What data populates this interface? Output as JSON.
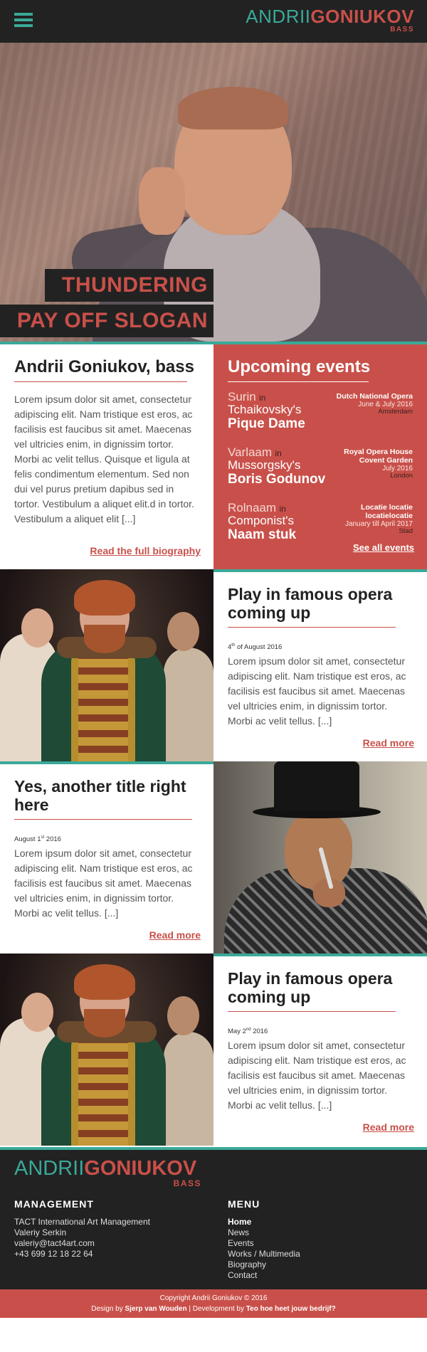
{
  "header": {
    "logo_first": "ANDRII",
    "logo_last": "GONIUKOV",
    "logo_sub": "BASS"
  },
  "hero": {
    "slogan_line1": "THUNDERING",
    "slogan_line2": "PAY OFF SLOGAN"
  },
  "bio": {
    "title": "Andrii Goniukov, bass",
    "text": "Lorem ipsum dolor sit amet, consectetur adipiscing elit. Nam tristique est eros, ac facilisis est faucibus sit amet. Maecenas vel ultricies enim, in dignissim tortor. Morbi ac velit tellus. Quisque et ligula at felis condimentum elementum. Sed non dui vel purus pretium dapibus sed in tortor. Vestibulum a aliquet elit.d in tortor. Vestibulum a aliquet elit [...]",
    "link": "Read the full biography"
  },
  "events": {
    "title": "Upcoming events",
    "in_word": "in",
    "items": [
      {
        "role": "Surin",
        "composer": "Tchaikovsky's",
        "work": "Pique Dame",
        "venue": "Dutch National Opera",
        "date": "June & July 2016",
        "city": "Amsterdam"
      },
      {
        "role": "Varlaam",
        "composer": "Mussorgsky's",
        "work": "Boris Godunov",
        "venue": "Royal Opera House Covent Garden",
        "date": "July 2016",
        "city": "London"
      },
      {
        "role": "Rolnaam",
        "composer": "Componist's",
        "work": "Naam stuk",
        "venue": "Locatie locatie locatielocatie",
        "date": "January till April 2017",
        "city": "Stad"
      }
    ],
    "see_all": "See all events"
  },
  "articles": [
    {
      "title": "Play in famous opera coming up",
      "date_day": "4",
      "date_sup": "th",
      "date_rest": " of August 2016",
      "text": "Lorem ipsum dolor sit amet, consectetur adipiscing elit. Nam tristique est eros, ac facilisis est faucibus sit amet. Maecenas vel ultricies enim, in dignissim tortor. Morbi ac velit tellus. [...]",
      "link": "Read more"
    },
    {
      "title": "Yes, another title right here",
      "date_day": "August 1",
      "date_sup": "st",
      "date_rest": " 2016",
      "text": "Lorem ipsum dolor sit amet, consectetur adipiscing elit. Nam tristique est eros, ac facilisis est faucibus sit amet. Maecenas vel ultricies enim, in dignissim tortor. Morbi ac velit tellus. [...]",
      "link": "Read more"
    },
    {
      "title": "Play in famous opera coming up",
      "date_day": "May 2",
      "date_sup": "nd",
      "date_rest": " 2016",
      "text": "Lorem ipsum dolor sit amet, consectetur adipiscing elit. Nam tristique est eros, ac facilisis est faucibus sit amet. Maecenas vel ultricies enim, in dignissim tortor. Morbi ac velit tellus. [...]",
      "link": "Read more"
    }
  ],
  "footer": {
    "logo_first": "ANDRII",
    "logo_last": "GONIUKOV",
    "logo_sub": "BASS",
    "management_heading": "MANAGEMENT",
    "management_lines": [
      "TACT International Art Management",
      "Valeriy Serkin",
      "valeriy@tact4art.com",
      "+43 699 12 18 22 64"
    ],
    "menu_heading": "MENU",
    "menu_items": [
      "Home",
      "News",
      "Events",
      "Works / Multimedia",
      "Biography",
      "Contact"
    ],
    "copyright": "Copyright Andrii Goniukov © 2016",
    "design_prefix": "Design by ",
    "designer": "Sjerp van Wouden",
    "dev_prefix": " | Development by ",
    "developer": "Teo hoe heet jouw bedrijf?"
  },
  "colors": {
    "accent_red": "#c9504a",
    "accent_teal": "#3aa999",
    "dark": "#222222"
  }
}
